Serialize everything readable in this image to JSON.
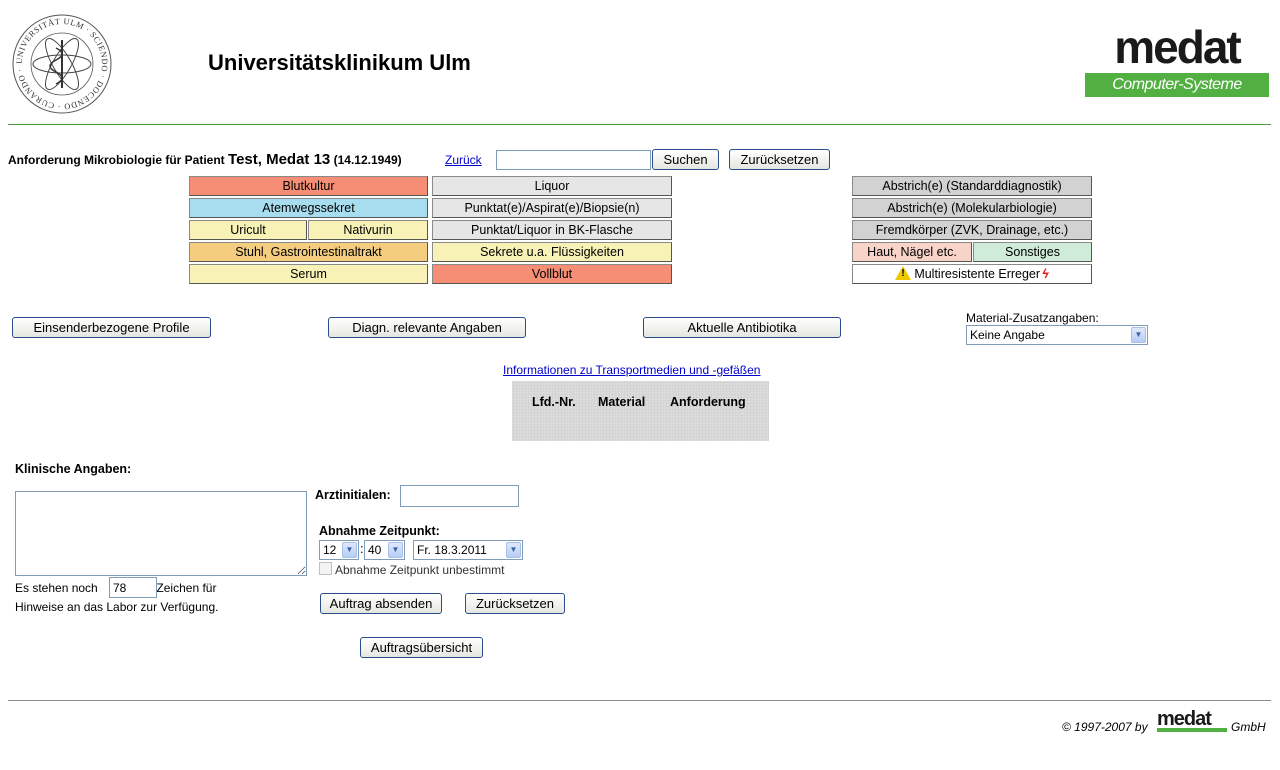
{
  "header": {
    "clinic_title": "Universitätsklinikum Ulm",
    "seal_text": "UNIVERSITÄT ULM · SCIENDO · DOCENDO · CURANDO ·",
    "logo_word": "medat",
    "logo_sub": "Computer-Systeme"
  },
  "request": {
    "prefix": "Anforderung Mikrobiologie für Patient",
    "patient_name": "Test, Medat 13",
    "patient_dob": "(14.12.1949)",
    "back_label": "Zurück",
    "search_value": "",
    "search_button": "Suchen",
    "reset_button": "Zurücksetzen"
  },
  "materials": {
    "col1": [
      "Blutkultur",
      "Atemwegssekret",
      "Uricult",
      "Nativurin",
      "Stuhl, Gastrointestinaltrakt",
      "Serum"
    ],
    "col2": [
      "Liquor",
      "Punktat(e)/Aspirat(e)/Biopsie(n)",
      "Punktat/Liquor in BK-Flasche",
      "Sekrete u.a. Flüssigkeiten",
      "Vollblut"
    ],
    "col3": [
      "Abstrich(e) (Standarddiagnostik)",
      "Abstrich(e) (Molekularbiologie)",
      "Fremdkörper (ZVK, Drainage, etc.)",
      "Haut, Nägel etc.",
      "Sonstiges",
      "Multiresistente Erreger"
    ]
  },
  "actions": {
    "profile_button": "Einsenderbezogene Profile",
    "diagnostic_button": "Diagn. relevante Angaben",
    "antibiotics_button": "Aktuelle Antibiotika"
  },
  "material_extra": {
    "label": "Material-Zusatzangaben:",
    "selected": "Keine Angabe"
  },
  "info_link": "Informationen zu Transportmedien und -gefäßen",
  "order_table": {
    "columns": [
      "Lfd.-Nr.",
      "Material",
      "Anforderung"
    ]
  },
  "clinical": {
    "label": "Klinische Angaben:",
    "remaining_prefix": "Es stehen noch",
    "remaining_value": "78",
    "remaining_suffix": "Zeichen für",
    "remaining_line2": "Hinweise an das Labor zur Verfügung."
  },
  "form": {
    "doctor_label": "Arztinitialen:",
    "doctor_value": "",
    "sample_time_label": "Abnahme Zeitpunkt:",
    "hour": "12",
    "minute": "40",
    "date": "Fr. 18.3.2011",
    "time_separator": ":",
    "undetermined_label": "Abnahme Zeitpunkt unbestimmt",
    "submit_button": "Auftrag absenden",
    "reset_button": "Zurücksetzen",
    "overview_button": "Auftragsübersicht"
  },
  "footer": {
    "copyright": "© 1997-2007 by",
    "logo_word": "medat",
    "suffix": "GmbH"
  },
  "colors": {
    "accent_green": "#52b043",
    "tile_red": "#f58e74",
    "tile_blue": "#a8ddf0",
    "tile_yellow": "#f8f2b6",
    "tile_orange": "#f4cd7e",
    "button_border": "#2b4d8c"
  }
}
